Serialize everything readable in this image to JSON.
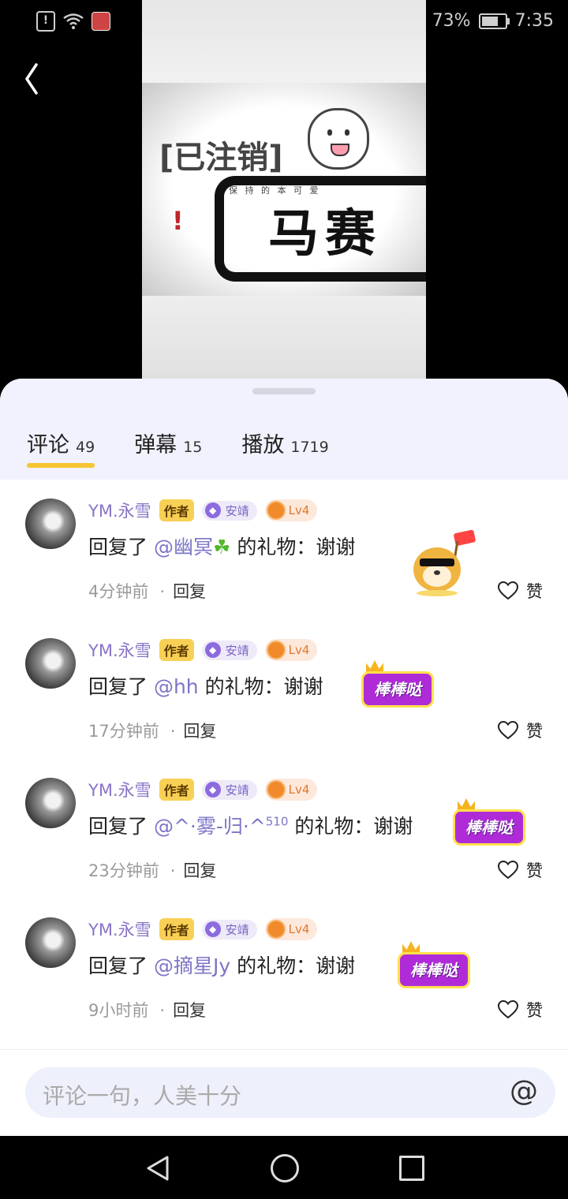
{
  "status_bar": {
    "battery": "73%",
    "time": "7:35"
  },
  "video": {
    "tag_text": "[已注销]",
    "big_text": "马赛",
    "small_text": "保 持 的 本 可 爱"
  },
  "tabs": [
    {
      "label": "评论",
      "count": "49"
    },
    {
      "label": "弹幕",
      "count": "15"
    },
    {
      "label": "播放",
      "count": "1719"
    }
  ],
  "comments": [
    {
      "user": "YM.永雪",
      "author_badge": "作者",
      "guard_badge": "安靖",
      "level": "Lv4",
      "prefix": "回复了 ",
      "mention": "@幽冥",
      "mention_sup": "",
      "suffix": " 的礼物：谢谢",
      "time": "4分钟前",
      "reply": "回复",
      "like": "赞"
    },
    {
      "user": "YM.永雪",
      "author_badge": "作者",
      "guard_badge": "安靖",
      "level": "Lv4",
      "prefix": "回复了 ",
      "mention": "@hh",
      "mention_sup": "",
      "suffix": " 的礼物：谢谢",
      "time": "17分钟前",
      "reply": "回复",
      "like": "赞"
    },
    {
      "user": "YM.永雪",
      "author_badge": "作者",
      "guard_badge": "安靖",
      "level": "Lv4",
      "prefix": "回复了 ",
      "mention": "@^·雾-归·^",
      "mention_sup": "510",
      "suffix": " 的礼物：谢谢",
      "time": "23分钟前",
      "reply": "回复",
      "like": "赞"
    },
    {
      "user": "YM.永雪",
      "author_badge": "作者",
      "guard_badge": "安靖",
      "level": "Lv4",
      "prefix": "回复了 ",
      "mention": "@摘星Jy",
      "mention_sup": "",
      "suffix": " 的礼物：谢谢",
      "time": "9小时前",
      "reply": "回复",
      "like": "赞"
    }
  ],
  "gift_label": "棒棒哒",
  "input": {
    "placeholder": "评论一句，人美十分",
    "at_icon": "@"
  },
  "icons": [
    "back-icon",
    "heart-icon",
    "at-icon",
    "nav-back-icon",
    "nav-home-icon",
    "nav-recent-icon"
  ],
  "colors": {
    "accent_yellow": "#f6c430",
    "mention_purple": "#7c76c7",
    "name_purple": "#8a74c8"
  }
}
